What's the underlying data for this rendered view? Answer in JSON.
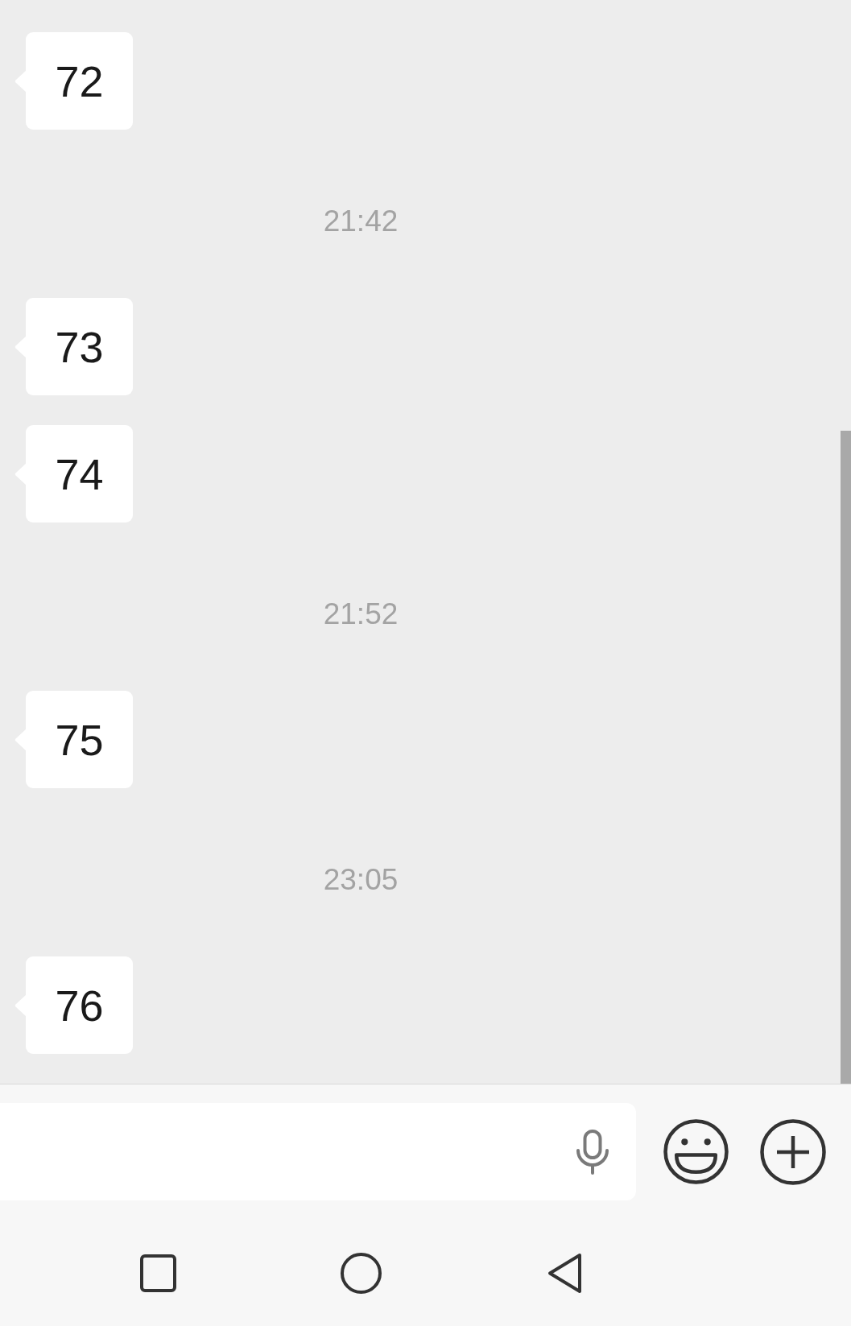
{
  "chat": {
    "items": [
      {
        "kind": "message",
        "text": "72"
      },
      {
        "kind": "time",
        "text": "21:42"
      },
      {
        "kind": "message",
        "text": "73"
      },
      {
        "kind": "message",
        "text": "74"
      },
      {
        "kind": "time",
        "text": "21:52"
      },
      {
        "kind": "message",
        "text": "75"
      },
      {
        "kind": "time",
        "text": "23:05"
      },
      {
        "kind": "message",
        "text": "76"
      }
    ]
  }
}
